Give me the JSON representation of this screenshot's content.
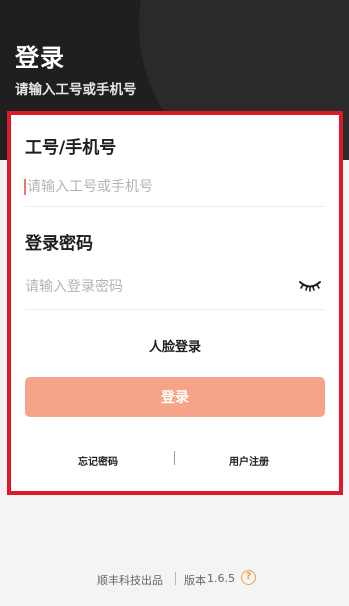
{
  "header": {
    "title": "登录",
    "subtitle": "请输入工号或手机号"
  },
  "form": {
    "account": {
      "label": "工号/手机号",
      "placeholder": "请输入工号或手机号",
      "value": ""
    },
    "password": {
      "label": "登录密码",
      "placeholder": "请输入登录密码",
      "value": "",
      "visibility_icon": "eye-closed-icon"
    },
    "face_login_label": "人脸登录",
    "login_button_label": "登录",
    "forgot_password_label": "忘记密码",
    "register_label": "用户注册"
  },
  "footer": {
    "company": "顺丰科技出品",
    "version_label": "版本",
    "version": "1.6.5",
    "help_icon": "question-circle-icon",
    "help_glyph": "?"
  },
  "colors": {
    "header_bg": "#1f1f1f",
    "accent": "#f6a487",
    "highlight_border": "#e0192a",
    "help_icon": "#f0a23c"
  }
}
